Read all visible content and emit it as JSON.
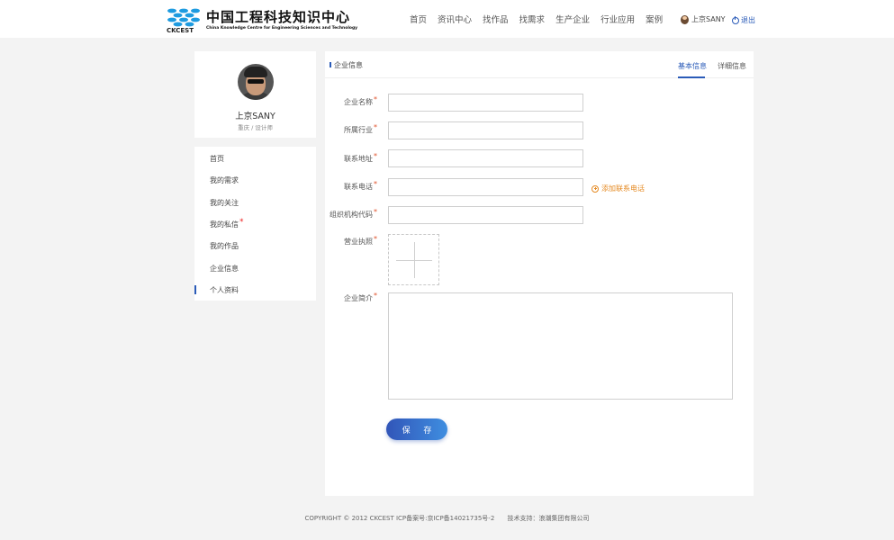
{
  "header": {
    "logo_title": "中国工程科技知识中心",
    "logo_subtitle": "China Knowledge Centre for Engineering Sciences and Technology",
    "logo_brand": "CKCEST",
    "nav": [
      "首页",
      "资讯中心",
      "找作品",
      "找需求",
      "生产企业",
      "行业应用",
      "案例"
    ],
    "user_name": "上京SANY",
    "logout_label": "退出"
  },
  "profile": {
    "name": "上京SANY",
    "role": "重庆 / 设计师"
  },
  "side_menu": {
    "items": [
      "首页",
      "我的需求",
      "我的关注",
      "我的私信",
      "我的作品",
      "企业信息",
      "个人资料"
    ],
    "active_index": 6
  },
  "panel": {
    "title": "企业信息",
    "tabs": [
      "基本信息",
      "详细信息"
    ],
    "active_tab": 0
  },
  "form": {
    "required_mark": "*",
    "company_name_label": "企业名称",
    "company_name_value": "",
    "industry_label": "所属行业",
    "industry_value": "",
    "address_label": "联系地址",
    "address_value": "",
    "phone_label": "联系电话",
    "phone_value": "",
    "add_phone_label": "添加联系电话",
    "org_code_label": "组织机构代码",
    "org_code_value": "",
    "license_label": "营业执照",
    "intro_label": "企业简介",
    "intro_value": "",
    "save_label": "保 存"
  },
  "footer": {
    "copyright": "COPYRIGHT © 2012 CKCEST ICP备案号:京ICP备14021735号-2",
    "support": "技术支持：浪潮集团有限公司"
  },
  "colors": {
    "accent": "#2a5bb8",
    "required": "#e0522c",
    "add_link": "#e58a23",
    "logo_blue": "#1e9be0"
  }
}
